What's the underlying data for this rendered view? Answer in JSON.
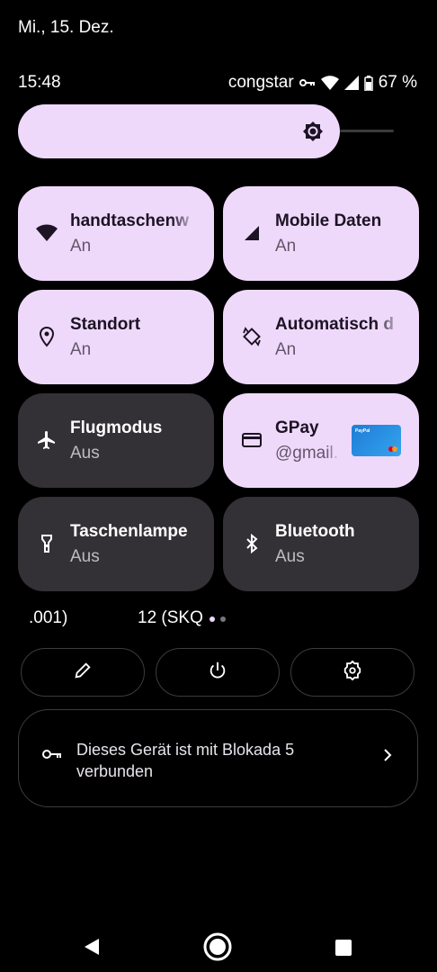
{
  "header": {
    "date": "Mi., 15. Dez."
  },
  "status": {
    "time": "15:48",
    "carrier": "congstar",
    "battery": "67 %"
  },
  "brightness": {
    "level_percent": 84
  },
  "tiles": [
    {
      "label": "handtaschenw",
      "state": "An",
      "icon": "wifi-icon",
      "active": true
    },
    {
      "label": "Mobile Daten",
      "state": "An",
      "icon": "cellular-icon",
      "active": true
    },
    {
      "label": "Standort",
      "state": "An",
      "icon": "location-icon",
      "active": true
    },
    {
      "label": "Automatisch d",
      "state": "An",
      "icon": "auto-rotate-icon",
      "active": true
    },
    {
      "label": "Flugmodus",
      "state": "Aus",
      "icon": "airplane-icon",
      "active": false
    },
    {
      "label": "GPay",
      "state": "@gmail.",
      "icon": "card-icon",
      "active": true,
      "card_label": "PayPal"
    },
    {
      "label": "Taschenlampe",
      "state": "Aus",
      "icon": "flashlight-icon",
      "active": false
    },
    {
      "label": "Bluetooth",
      "state": "Aus",
      "icon": "bluetooth-icon",
      "active": false
    }
  ],
  "footer": {
    "build_left": ".001)",
    "build_right": "12 (SKQ",
    "page_dots": 2,
    "active_page": 0
  },
  "actions": [
    {
      "icon": "edit-icon"
    },
    {
      "icon": "power-icon"
    },
    {
      "icon": "settings-icon"
    }
  ],
  "vpn_banner": {
    "text": "Dieses Gerät ist mit Blokada 5 verbunden",
    "icon": "key-icon"
  },
  "colors": {
    "tile_on": "#efd9fb",
    "tile_off": "#333036",
    "background": "#000000"
  }
}
